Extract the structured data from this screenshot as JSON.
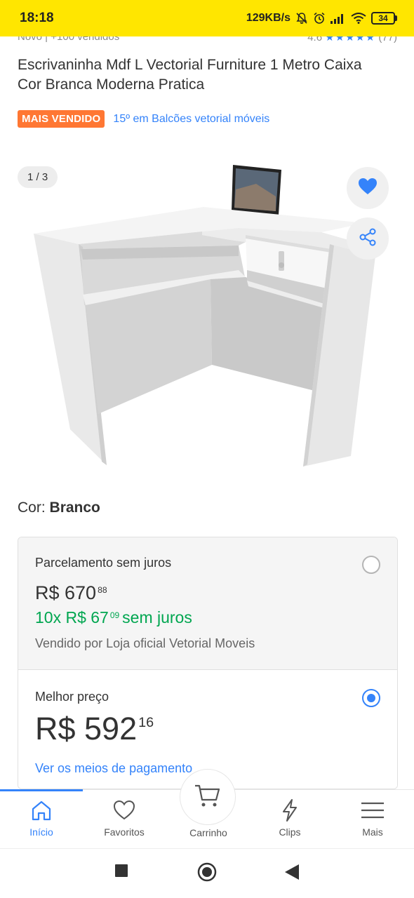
{
  "status_bar": {
    "time": "18:18",
    "network_speed": "129KB/s",
    "battery": "34",
    "icons": [
      "mute-bell-icon",
      "alarm-icon",
      "signal-icon",
      "wifi-icon",
      "battery-icon"
    ]
  },
  "product": {
    "meta_left": "Novo  |  +100 vendidos",
    "rating_value": "4.6",
    "rating_stars": 4.5,
    "rating_count": "(77)",
    "title": "Escrivaninha Mdf L Vectorial Furniture 1 Metro Caixa Cor Branca Moderna Pratica",
    "badge": "MAIS VENDIDO",
    "ranking": "15º em Balcões vetorial móveis"
  },
  "gallery": {
    "counter": "1 / 3",
    "icons": [
      "heart-icon",
      "share-icon"
    ]
  },
  "color": {
    "label": "Cor:",
    "value": "Branco"
  },
  "payment_options": [
    {
      "title": "Parcelamento sem juros",
      "price_main": "R$ 670",
      "price_cents": "88",
      "installments_prefix": "10x R$ 67",
      "installments_cents": "09",
      "installments_suffix": "sem juros",
      "seller": "Vendido por Loja oficial Vetorial Moveis",
      "selected": false
    },
    {
      "title": "Melhor preço",
      "price_main": "R$ 592",
      "price_cents": "16",
      "link": "Ver os meios de pagamento",
      "selected": true
    }
  ],
  "bottom_nav": [
    {
      "label": "Início",
      "icon": "home-icon",
      "active": true
    },
    {
      "label": "Favoritos",
      "icon": "heart-outline-icon",
      "active": false
    },
    {
      "label": "Carrinho",
      "icon": "cart-icon",
      "active": false
    },
    {
      "label": "Clips",
      "icon": "lightning-icon",
      "active": false
    },
    {
      "label": "Mais",
      "icon": "menu-icon",
      "active": false
    }
  ],
  "colors": {
    "brand_yellow": "#ffe600",
    "accent_blue": "#3483fa",
    "badge_orange": "#ff7733",
    "price_green": "#00a650"
  }
}
